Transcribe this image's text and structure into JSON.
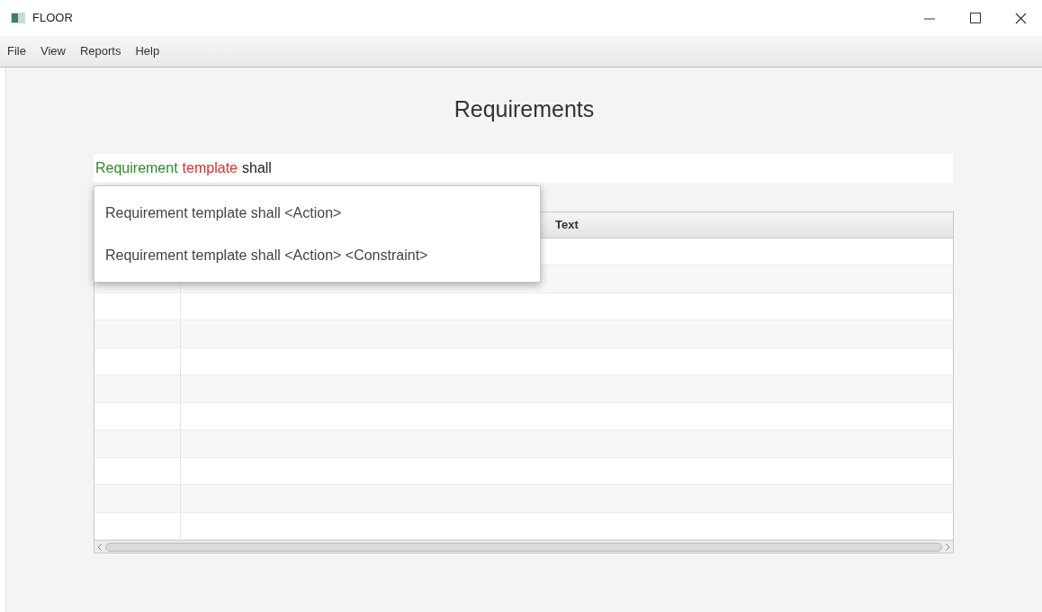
{
  "window": {
    "title": "FLOOR"
  },
  "menu": [
    "File",
    "View",
    "Reports",
    "Help"
  ],
  "heading": "Requirements",
  "input": {
    "tokens": [
      {
        "text": "Requirement",
        "color": "#2e8b2e"
      },
      {
        "text": "template",
        "color": "#d9302c"
      },
      {
        "text": "shall",
        "color": "#222222"
      }
    ]
  },
  "suggestions": [
    "Requirement template shall <Action>",
    "Requirement template shall <Action> <Constraint>"
  ],
  "table": {
    "columns": [
      "Text"
    ]
  }
}
